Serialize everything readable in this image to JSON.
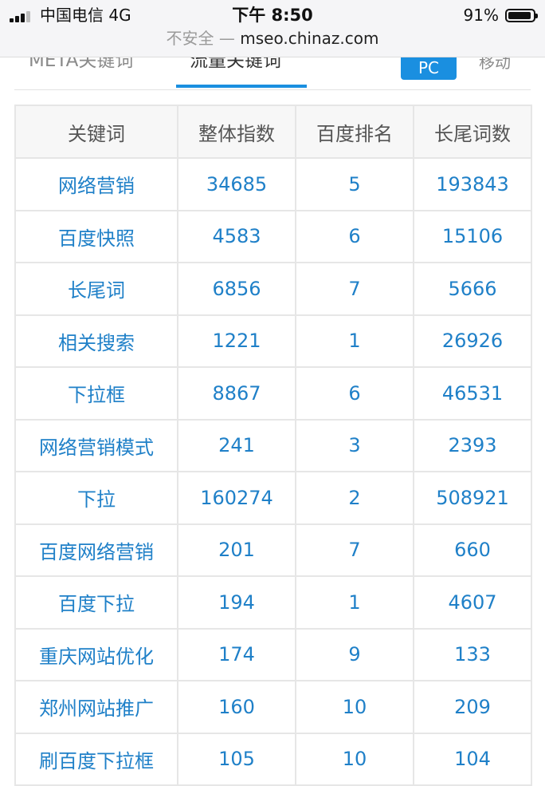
{
  "status_bar": {
    "carrier": "中国电信  4G",
    "time": "下午 8:50",
    "battery": "91%"
  },
  "address_bar": {
    "insecure_label": "不安全 —",
    "url": "mseo.chinaz.com"
  },
  "tabs": {
    "meta_keywords": "META关键词",
    "traffic_keywords": "流量关键词",
    "pc": "PC",
    "mobile": "移动"
  },
  "table": {
    "headers": [
      "关键词",
      "整体指数",
      "百度排名",
      "长尾词数"
    ],
    "rows": [
      [
        "网络营销",
        "34685",
        "5",
        "193843"
      ],
      [
        "百度快照",
        "4583",
        "6",
        "15106"
      ],
      [
        "长尾词",
        "6856",
        "7",
        "5666"
      ],
      [
        "相关搜索",
        "1221",
        "1",
        "26926"
      ],
      [
        "下拉框",
        "8867",
        "6",
        "46531"
      ],
      [
        "网络营销模式",
        "241",
        "3",
        "2393"
      ],
      [
        "下拉",
        "160274",
        "2",
        "508921"
      ],
      [
        "百度网络营销",
        "201",
        "7",
        "660"
      ],
      [
        "百度下拉",
        "194",
        "1",
        "4607"
      ],
      [
        "重庆网站优化",
        "174",
        "9",
        "133"
      ],
      [
        "郑州网站推广",
        "160",
        "10",
        "209"
      ],
      [
        "刷百度下拉框",
        "105",
        "10",
        "104"
      ]
    ]
  },
  "colors": {
    "accent": "#1a8fe0",
    "link": "#1f80c8",
    "header_bg": "#f7f7f7",
    "border": "#e6e6e6"
  }
}
